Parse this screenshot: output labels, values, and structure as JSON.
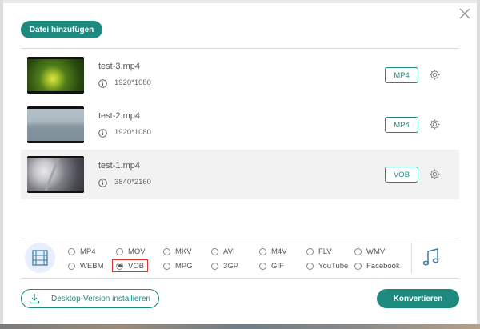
{
  "toolbar": {
    "add_label": "Datei hinzufügen"
  },
  "files": [
    {
      "name": "test-3.mp4",
      "resolution": "1920*1080",
      "format": "MP4",
      "thumbnail": "green-foliage-icon"
    },
    {
      "name": "test-2.mp4",
      "resolution": "1920*1080",
      "format": "MP4",
      "thumbnail": "misty-lake-icon"
    },
    {
      "name": "test-1.mp4",
      "resolution": "3840*2160",
      "format": "VOB",
      "thumbnail": "snowy-road-icon"
    }
  ],
  "formats": {
    "row1": [
      "MP4",
      "MOV",
      "MKV",
      "AVI",
      "M4V",
      "FLV",
      "WMV"
    ],
    "row2": [
      "WEBM",
      "VOB",
      "MPG",
      "3GP",
      "GIF",
      "YouTube",
      "Facebook"
    ],
    "selected": "VOB"
  },
  "footer": {
    "desktop_label": "Desktop-Version installieren",
    "convert_label": "Konvertieren"
  },
  "colors": {
    "accent": "#1e8a7f",
    "selection_outline": "#d9302c"
  }
}
